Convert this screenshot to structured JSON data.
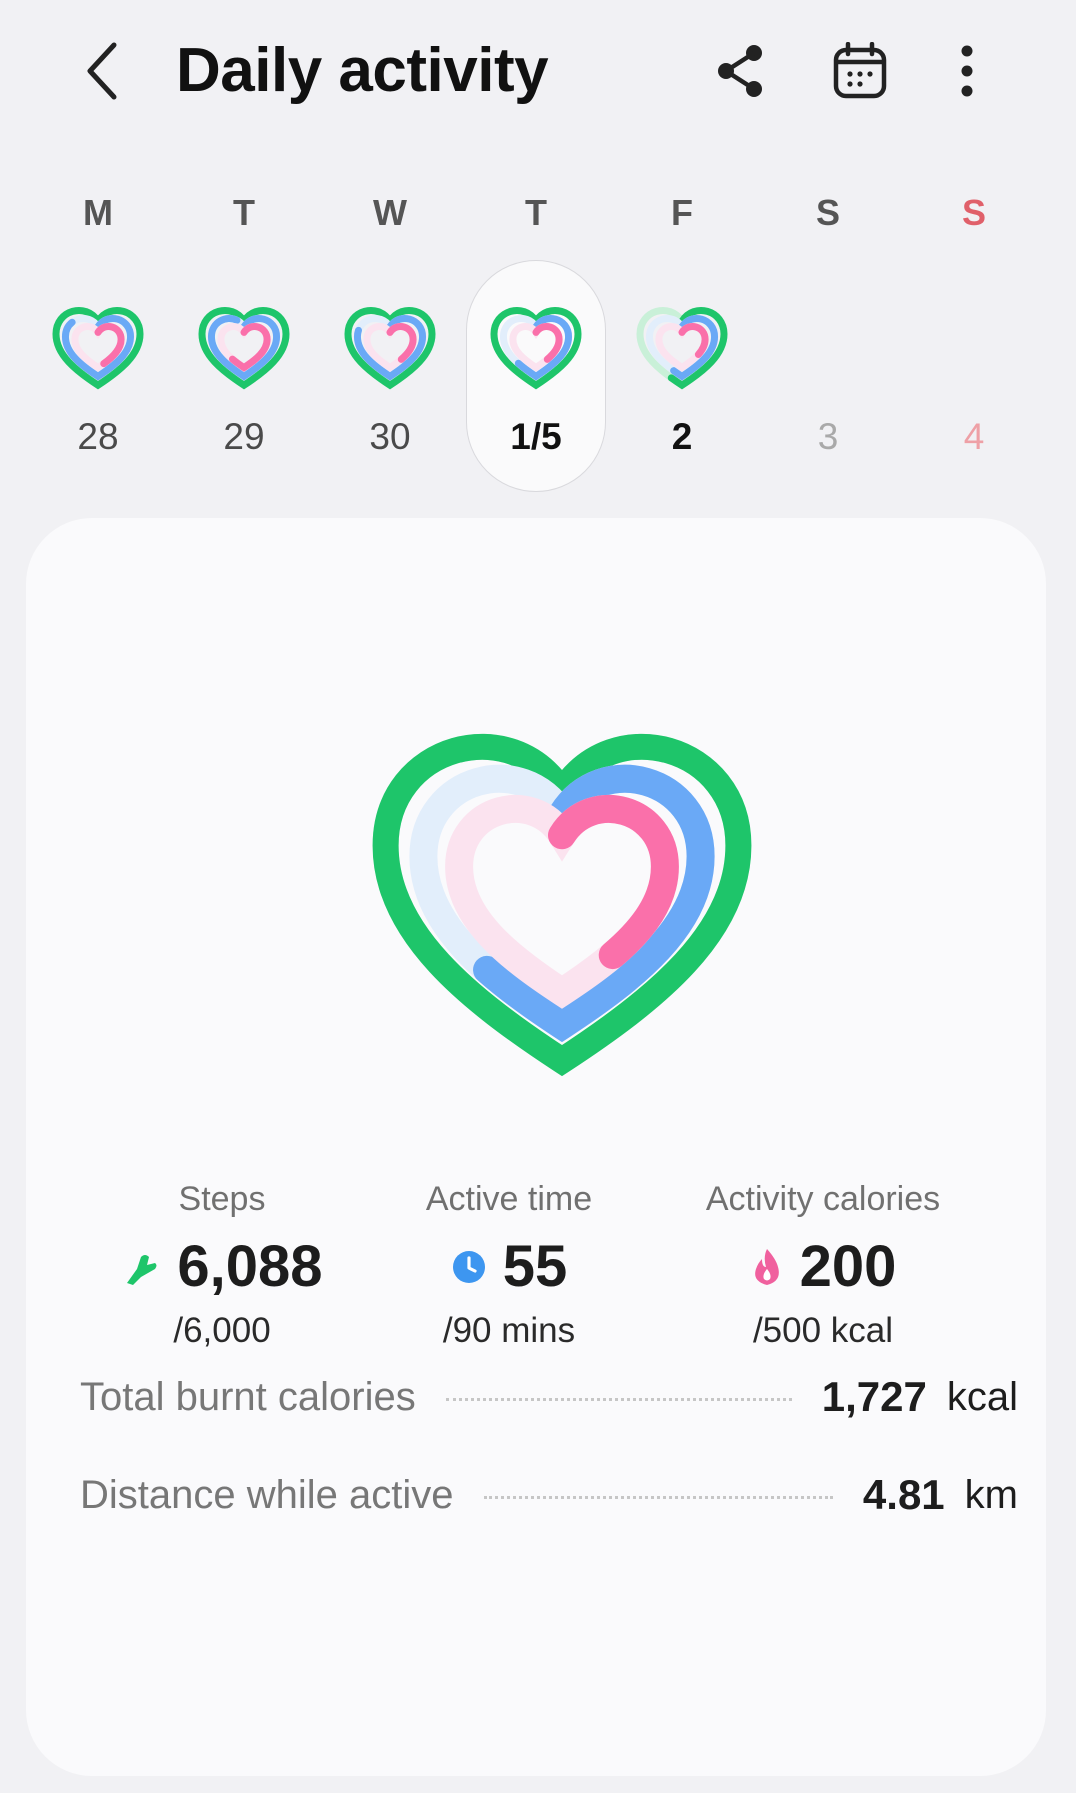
{
  "header": {
    "title": "Daily activity",
    "back_icon": "chevron-left-icon",
    "share_icon": "share-icon",
    "calendar_icon": "calendar-icon",
    "more_icon": "more-vertical-icon"
  },
  "week": {
    "days": [
      {
        "dow": "M",
        "date": "28",
        "state": "past",
        "has_ring": true
      },
      {
        "dow": "T",
        "date": "29",
        "state": "past",
        "has_ring": true
      },
      {
        "dow": "W",
        "date": "30",
        "state": "past",
        "has_ring": true
      },
      {
        "dow": "T",
        "date": "1/5",
        "state": "selected",
        "has_ring": true
      },
      {
        "dow": "F",
        "date": "2",
        "state": "today",
        "has_ring": true
      },
      {
        "dow": "S",
        "date": "3",
        "state": "future",
        "has_ring": false
      },
      {
        "dow": "S",
        "date": "4",
        "state": "future",
        "has_ring": false
      }
    ]
  },
  "summary": {
    "steps": {
      "label": "Steps",
      "value": "6,088",
      "goal": "/6,000",
      "icon": "shoe-icon",
      "color": "#1ec56a"
    },
    "active_time": {
      "label": "Active time",
      "value": "55",
      "goal": "/90 mins",
      "icon": "clock-icon",
      "color": "#3d96f0"
    },
    "calories": {
      "label": "Activity calories",
      "value": "200",
      "goal": "/500 kcal",
      "icon": "flame-icon",
      "color": "#f0609e"
    }
  },
  "progress": {
    "steps_fraction": 1.0,
    "active_fraction": 0.61,
    "calories_fraction": 0.4
  },
  "details": {
    "total_burnt": {
      "label": "Total burnt calories",
      "value": "1,727",
      "unit": "kcal"
    },
    "distance": {
      "label": "Distance while active",
      "value": "4.81",
      "unit": "km"
    }
  },
  "colors": {
    "green": "#1ec56a",
    "blue": "#6aa9f6",
    "pink": "#fa70aa",
    "green_light": "#c9f0d8",
    "blue_light": "#e2eefb",
    "pink_light": "#fbe3ef",
    "sunday_red": "#e0606a"
  }
}
